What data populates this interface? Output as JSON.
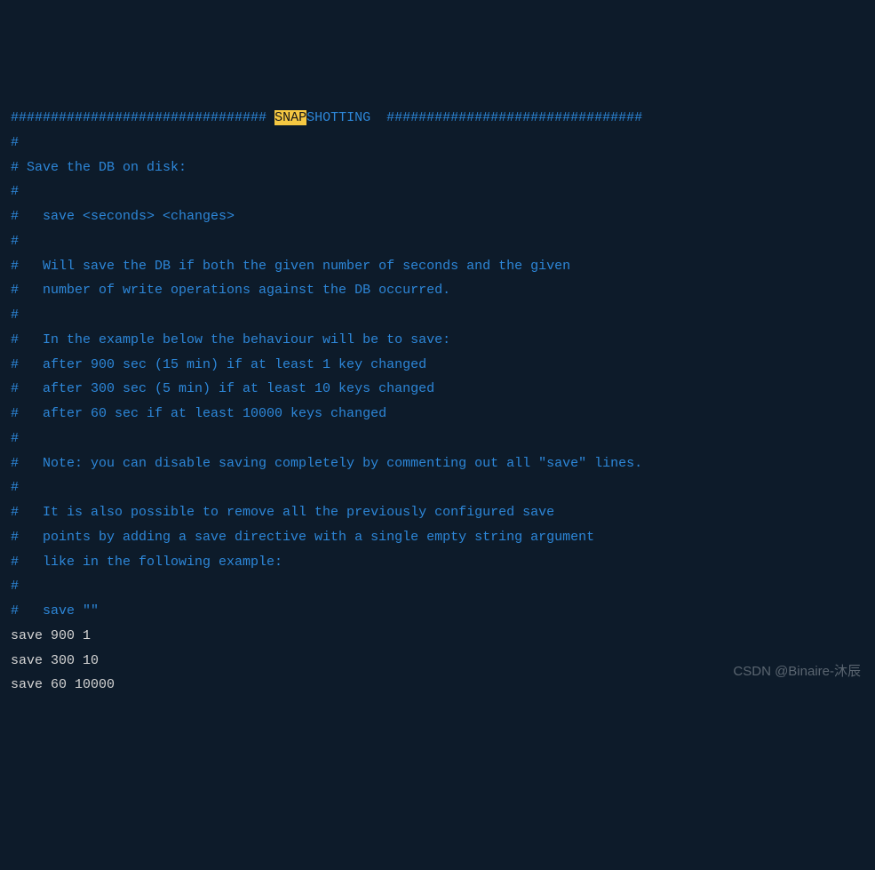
{
  "header": {
    "hash_left": "################################",
    "highlighted": "SNAP",
    "after_highlight": "SHOTTING",
    "hash_right": "################################"
  },
  "comments": [
    "#",
    "# Save the DB on disk:",
    "#",
    "#   save <seconds> <changes>",
    "#",
    "#   Will save the DB if both the given number of seconds and the given",
    "#   number of write operations against the DB occurred.",
    "#",
    "#   In the example below the behaviour will be to save:",
    "#   after 900 sec (15 min) if at least 1 key changed",
    "#   after 300 sec (5 min) if at least 10 keys changed",
    "#   after 60 sec if at least 10000 keys changed",
    "#",
    "#   Note: you can disable saving completely by commenting out all \"save\" lines.",
    "#",
    "#   It is also possible to remove all the previously configured save",
    "#   points by adding a save directive with a single empty string argument",
    "#   like in the following example:",
    "#",
    "#   save \"\""
  ],
  "blank": "",
  "code_lines": [
    "save 900 1",
    "save 300 10",
    "save 60 10000"
  ],
  "watermark": "CSDN @Binaire-沐辰"
}
